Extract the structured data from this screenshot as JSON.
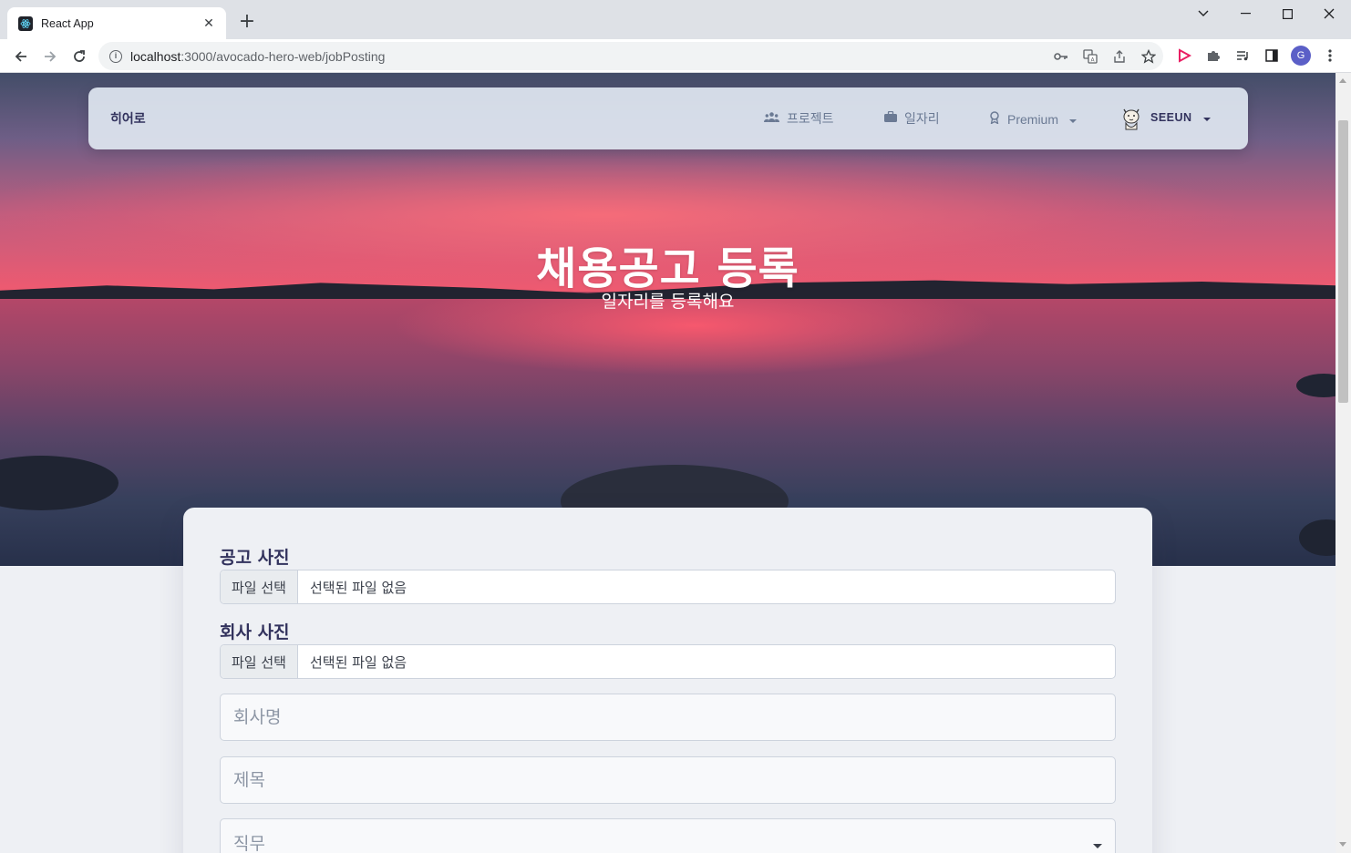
{
  "browser": {
    "tab_title": "React App",
    "tab_close": "✕",
    "new_tab": "+",
    "url_host": "localhost",
    "url_rest": ":3000/avocado-hero-web/jobPosting",
    "profile_initial": "G",
    "icons": [
      "key-icon",
      "translate-icon",
      "share-icon",
      "star-icon",
      "play-extension-icon",
      "puzzle-icon",
      "media-icon",
      "sidepanel-icon",
      "kebab-menu-icon"
    ]
  },
  "navbar": {
    "brand": "히어로",
    "items": [
      {
        "label": "프로젝트",
        "icon": "users-icon"
      },
      {
        "label": "일자리",
        "icon": "briefcase-icon"
      },
      {
        "label": "Premium",
        "icon": "award-icon"
      }
    ],
    "user": "SEEUN"
  },
  "hero": {
    "title": "채용공고 등록",
    "subtitle": "일자리를 등록해요"
  },
  "form": {
    "job_photo_label": "공고 사진",
    "company_photo_label": "회사 사진",
    "file_button": "파일 선택",
    "file_none": "선택된 파일 없음",
    "company_name_placeholder": "회사명",
    "title_placeholder": "제목",
    "role_placeholder": "직무"
  },
  "colors": {
    "navbar_text": "#6b7a94",
    "heading": "#32325d",
    "page_bg": "#eef0f4"
  }
}
